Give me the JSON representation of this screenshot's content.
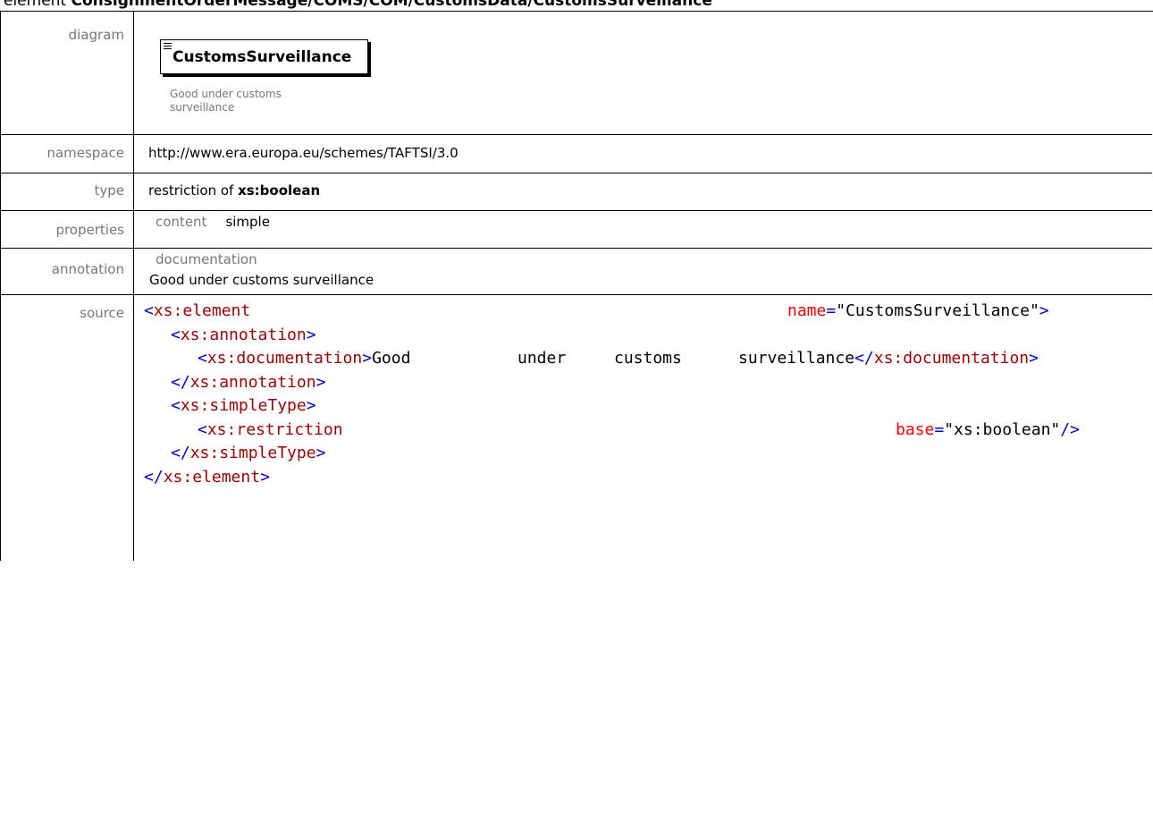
{
  "page": {
    "title_prefix": "element ",
    "title_path": "ConsignmentOrderMessage/COMS/COM/CustomsData/CustomsSurveillance"
  },
  "diagram": {
    "label": "diagram",
    "element_name": "CustomsSurveillance",
    "note": "Good under customs surveillance"
  },
  "namespace": {
    "label": "namespace",
    "value": "http://www.era.europa.eu/schemes/TAFTSI/3.0"
  },
  "type": {
    "label": "type",
    "prefix": "restriction of ",
    "base": "xs:boolean"
  },
  "properties": {
    "label": "properties",
    "key": "content",
    "value": "simple"
  },
  "annotation": {
    "label": "annotation",
    "key": "documentation",
    "value": "Good under customs surveillance"
  },
  "source": {
    "label": "source",
    "element_open": "xs:element",
    "name_attr": "name",
    "name_value": "\"CustomsSurveillance\"",
    "annotation_tag": "xs:annotation",
    "documentation_tag": "xs:documentation",
    "doc_words": [
      "Good",
      "under",
      "customs",
      "surveillance"
    ],
    "simpletype_tag": "xs:simpleType",
    "restriction_tag": "xs:restriction",
    "base_attr": "base",
    "base_value": "\"xs:boolean\""
  }
}
